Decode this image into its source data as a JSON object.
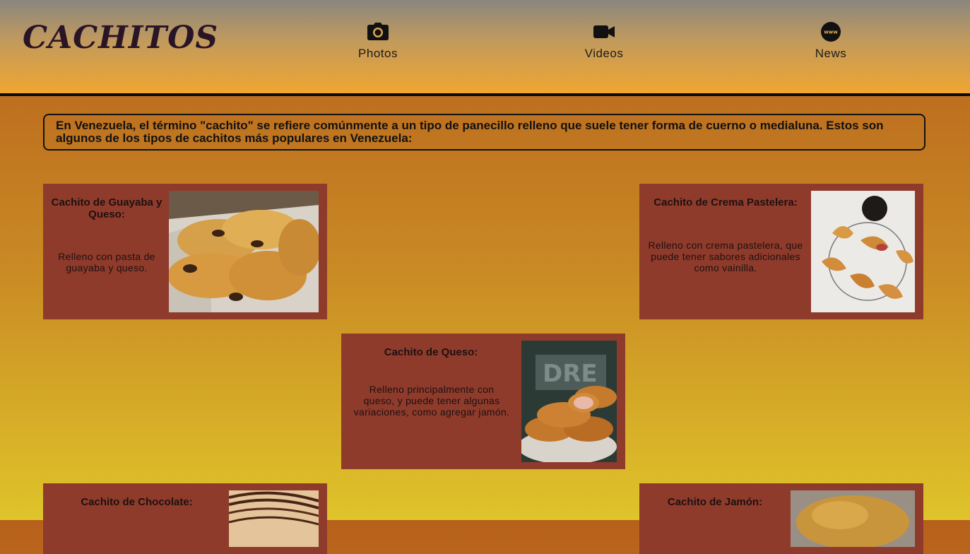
{
  "brand": {
    "logo_text": "CACHITOS"
  },
  "nav": [
    {
      "label": "Photos",
      "icon": "camera-icon"
    },
    {
      "label": "Videos",
      "icon": "video-camera-icon"
    },
    {
      "label": "News",
      "icon": "www-globe-icon"
    }
  ],
  "intro": {
    "text": "En Venezuela, el término \"cachito\" se refiere comúnmente a un tipo de panecillo relleno que suele tener forma de cuerno o medialuna. Estos son algunos de los tipos de cachitos más populares en Venezuela:"
  },
  "cards": [
    {
      "title": "Cachito de Guayaba y Queso:",
      "description": "Relleno con pasta de guayaba y queso.",
      "image": "chocolate-croissants-photo"
    },
    {
      "title": "Cachito de Crema Pastelera:",
      "description": "Relleno con crema pastelera, que puede tener sabores adicionales como vainilla.",
      "image": "croissants-on-rack-photo"
    },
    {
      "title": "Cachito de Queso:",
      "description": "Relleno principalmente con queso, y puede tener algunas variaciones, como agregar jamón.",
      "image": "ham-cheese-rolls-photo"
    },
    {
      "title": "Cachito de Chocolate:",
      "description": "",
      "image": "chocolate-drizzle-pastry-photo"
    },
    {
      "title": "Cachito de Jamón:",
      "description": "",
      "image": "ham-cachito-photo"
    }
  ],
  "colors": {
    "card_background": "#8f3b2b",
    "header_bottom": "#f0a630",
    "page_top": "#b7601c",
    "page_bottom": "#dfc42a"
  }
}
